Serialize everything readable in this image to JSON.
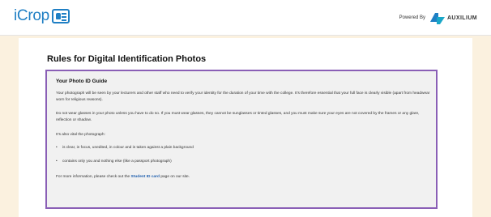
{
  "header": {
    "logo_text": "iCrop",
    "powered_by": "Powered By",
    "partner_name": "AUXILIUM"
  },
  "main": {
    "page_title": "Rules for Digital Identification Photos",
    "guide": {
      "title": "Your Photo ID Guide",
      "para1": "Your photograph will be seen by your lecturers and other staff who need to verify your identity for the duration of your time with the college. It's therefore essential that your full face is clearly visible (apart from headwear worn for religious reasons).",
      "para2": "Do not wear glasses in your photo unless you have to do so. If you must wear glasses, they cannot be sunglasses or tinted glasses, and you must make sure your eyes are not covered by the frames or any glare, reflection or shadow.",
      "para3": "It's also vital the photograph:",
      "bullets": [
        "is clear, in focus, unedited, in colour and is taken against a plain background",
        "contains only you and nothing else (like a passport photograph)"
      ],
      "footer_prefix": "For more information, please check out the ",
      "footer_link": "Student ID card",
      "footer_suffix": " page on our site."
    }
  },
  "colors": {
    "background": "#fbf1df",
    "brand_blue": "#1f7fc4",
    "guide_border": "#8a5fb6",
    "link": "#1f5fae"
  }
}
